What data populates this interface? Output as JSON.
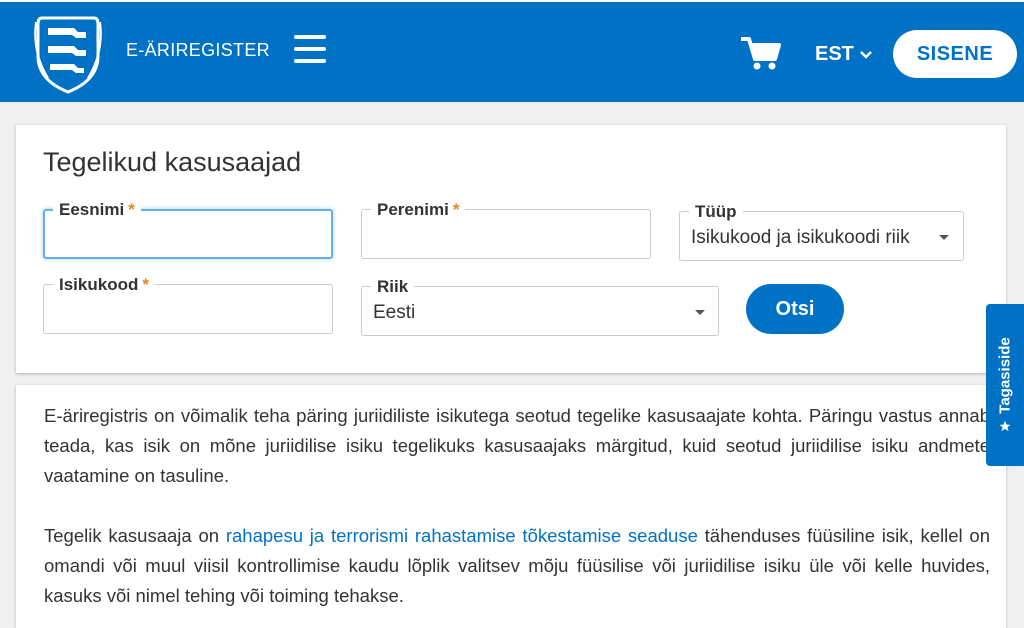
{
  "header": {
    "brand": "E-ÄRIREGISTER",
    "language": "EST",
    "login_label": "SISENE",
    "colors": {
      "primary": "#0072c6",
      "focus": "#66afe9",
      "required": "#e3861c"
    },
    "icons": [
      "coat-of-arms-logo",
      "hamburger-menu-icon",
      "cart-icon",
      "chevron-down-icon"
    ]
  },
  "search": {
    "title": "Tegelikud kasusaajad",
    "first_name": {
      "label": "Eesnimi",
      "required_mark": "*",
      "value": ""
    },
    "last_name": {
      "label": "Perenimi",
      "required_mark": "*",
      "value": ""
    },
    "type": {
      "label": "Tüüp",
      "selected": "Isikukood ja isikukoodi riik"
    },
    "id_code": {
      "label": "Isikukood",
      "required_mark": "*",
      "value": ""
    },
    "country": {
      "label": "Riik",
      "selected": "Eesti"
    },
    "submit_label": "Otsi"
  },
  "info": {
    "p1": "E-äriregistris on võimalik teha päring juriidiliste isikutega seotud tegelike kasusaajate kohta. Päringu vastus annab teada, kas isik on mõne juriidilise isiku tegelikuks kasusaajaks märgitud, kuid seotud juriidilise isiku andmete vaatamine on tasuline.",
    "p2_before": "Tegelik kasusaaja on ",
    "p2_link": "rahapesu ja terrorismi rahastamise tõkestamise seaduse",
    "p2_after": " tähenduses füüsiline isik, kellel on omandi või muul viisil kontrollimise kaudu lõplik valitsev mõju füüsilise või juriidilise isiku üle või kelle huvides, kasuks või nimel tehing või toiming tehakse."
  },
  "feedback": {
    "label": "Tagasiside",
    "icon": "star-icon"
  }
}
